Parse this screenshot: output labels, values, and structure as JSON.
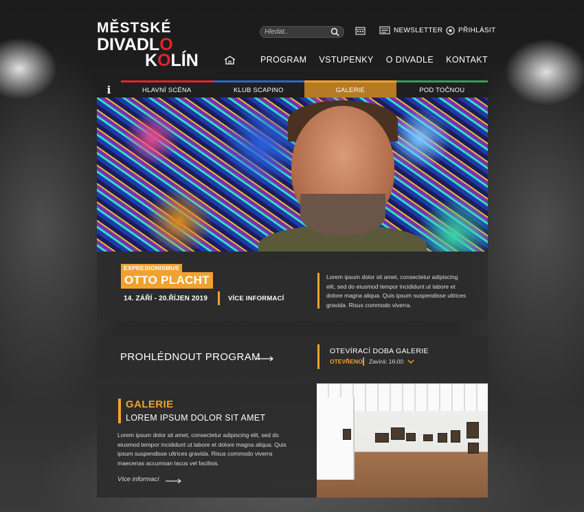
{
  "logo": {
    "line1": "MĚSTSKÉ",
    "line2a": "DIVADL",
    "line2b": "O",
    "line3a": "K",
    "line3b": "O",
    "line3c": "LÍN"
  },
  "header": {
    "search_placeholder": "Hledat..",
    "newsletter": "NEWSLETTER",
    "login": "PŘIHLÁSIT"
  },
  "nav": [
    "PROGRAM",
    "VSTUPENKY",
    "O DIVADLE",
    "KONTAKT"
  ],
  "subnav": {
    "info": "i",
    "tabs": [
      "HLAVNÍ SCÉNA",
      "KLUB SCAPINO",
      "GALERIE",
      "POD TOČNOU"
    ]
  },
  "event": {
    "badge": "EXPRESIONISMUS",
    "name": "OTTO PLACHT",
    "dates": "14. ZÁŘÍ - 20.ŘÍJEN 2019",
    "more": "VÍCE INFORMACÍ",
    "description": "Lorem ipsum dolor sit amet, consectetur adipiscing elit, sed do eiusmod tempor incididunt ut labore et dolore magna aliqua. Quis ipsum suspendisse ultrices gravida. Risus commodo viverra."
  },
  "program": {
    "browse": "PROHLÉDNOUT PROGRAM",
    "hours_title": "OTEVÍRACÍ DOBA GALERIE",
    "open_status": "OTEVŘENO",
    "closes": "Zavírá: 16:00"
  },
  "gallery": {
    "title": "GALERIE",
    "subtitle": "LOREM IPSUM DOLOR SIT AMET",
    "text": "Lorem ipsum dolor sit amet, consectetur adipiscing elit, sed do eiusmod tempor incididunt ut labore et dolore magna aliqua. Quis ipsum suspendisse ultrices gravida. Risus commodo viverra maecenas accumsan lacus vel facilisis.",
    "more": "Více informací"
  },
  "colors": {
    "accent": "#f0a22f",
    "red": "#e0262c",
    "blue": "#2a69c8",
    "green": "#37a05a"
  }
}
